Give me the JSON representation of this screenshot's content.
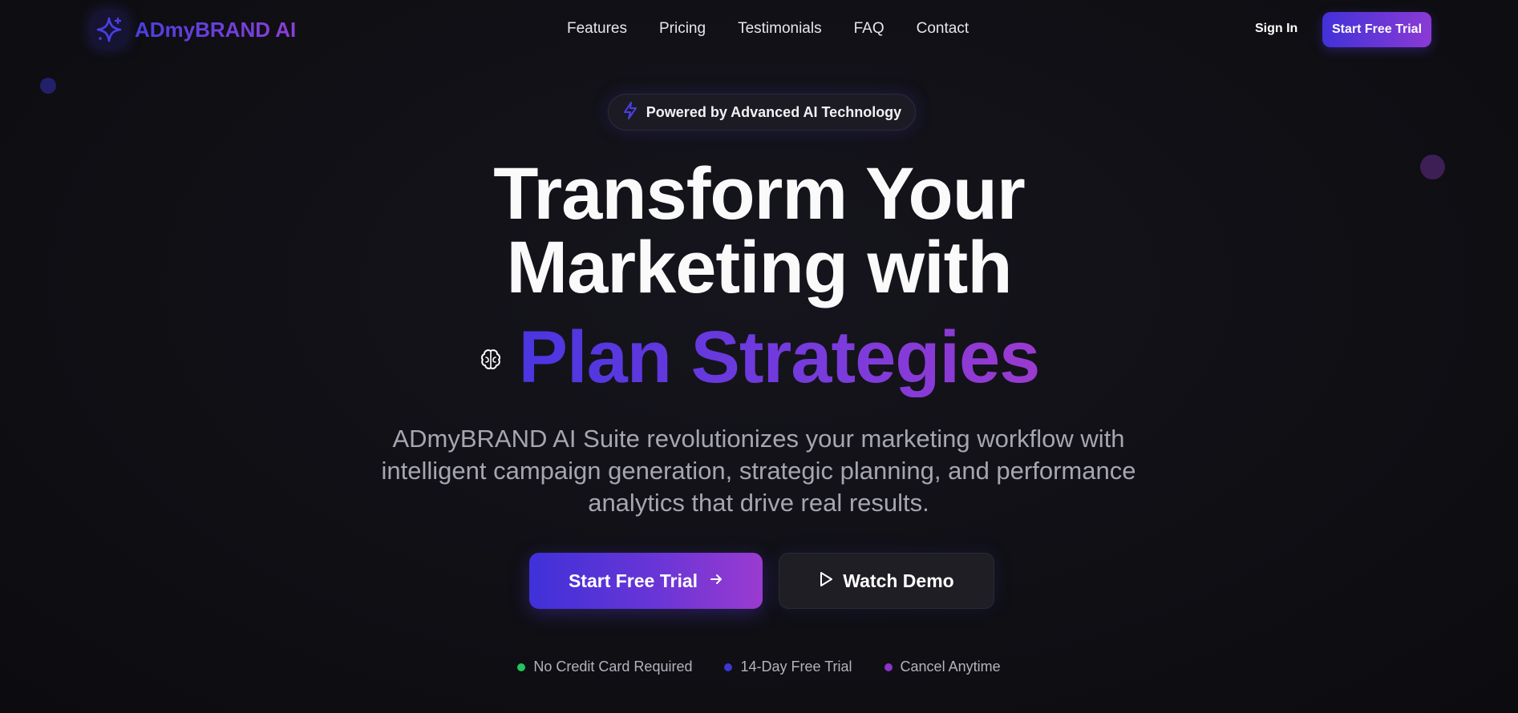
{
  "brand": {
    "name": "ADmyBRAND AI",
    "icon": "sparkle-icon",
    "gradient": [
      "#4b3fe0",
      "#8c3fd6"
    ]
  },
  "nav": {
    "links": [
      {
        "label": "Features"
      },
      {
        "label": "Pricing"
      },
      {
        "label": "Testimonials"
      },
      {
        "label": "FAQ"
      },
      {
        "label": "Contact"
      }
    ],
    "sign_in": "Sign In",
    "cta": "Start Free Trial"
  },
  "hero": {
    "badge": {
      "icon": "lightning-icon",
      "text": "Powered by Advanced AI Technology"
    },
    "headline_line1": "Transform Your",
    "headline_line2": "Marketing with",
    "rotating_icon": "brain-icon",
    "rotating_text": "Plan Strategies",
    "subtitle": "ADmyBRAND AI Suite revolutionizes your marketing workflow with intelligent campaign generation, strategic planning, and performance analytics that drive real results.",
    "primary_cta": {
      "label": "Start Free Trial",
      "icon": "arrow-right-icon"
    },
    "secondary_cta": {
      "label": "Watch Demo",
      "icon": "play-icon"
    }
  },
  "perks": [
    {
      "label": "No Credit Card Required",
      "color": "#22c55e"
    },
    {
      "label": "14-Day Free Trial",
      "color": "#3b36d4"
    },
    {
      "label": "Cancel Anytime",
      "color": "#8b34c8"
    }
  ],
  "colors": {
    "background": "#0f0f14",
    "accent_start": "#4232d8",
    "accent_end": "#8b3ad4"
  }
}
